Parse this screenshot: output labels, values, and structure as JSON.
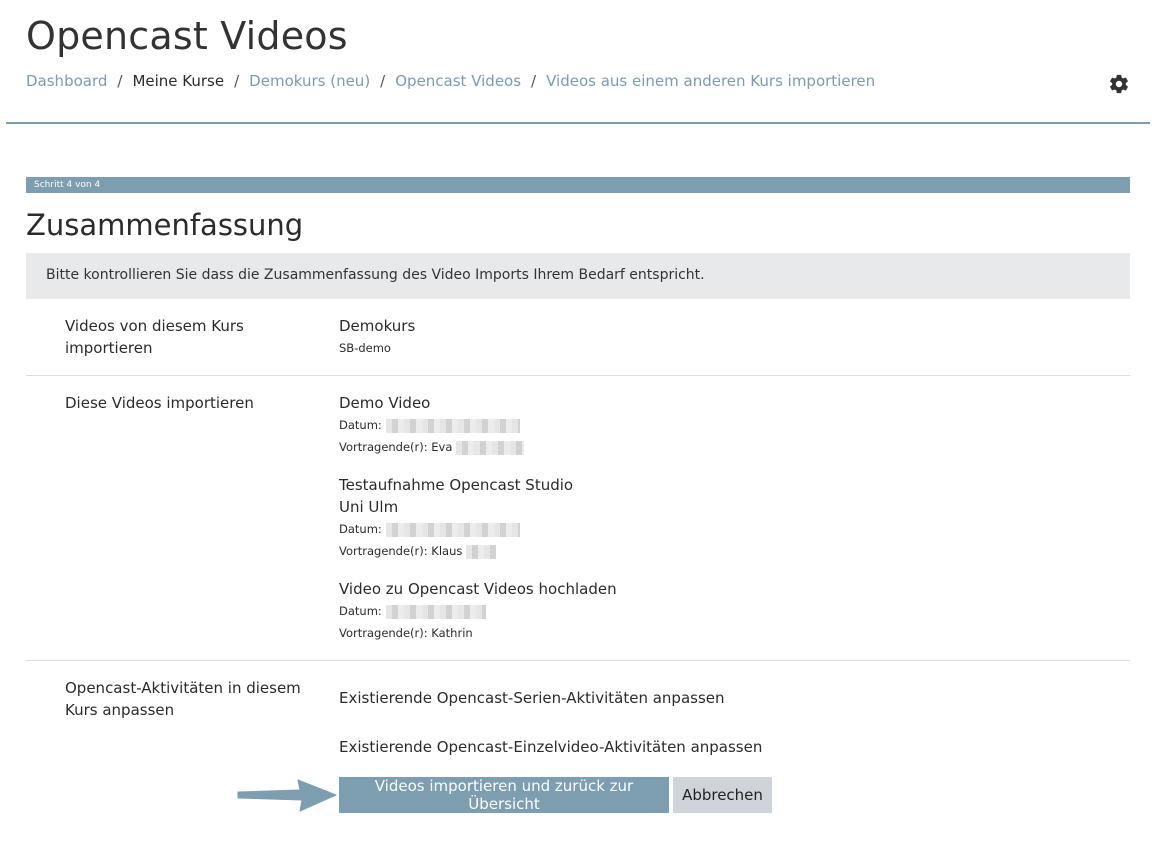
{
  "header": {
    "title": "Opencast Videos",
    "breadcrumb": [
      "Dashboard",
      "Meine Kurse",
      "Demokurs (neu)",
      "Opencast Videos",
      "Videos aus einem anderen Kurs importieren"
    ],
    "settings_icon": "gear-icon"
  },
  "progress": {
    "label": "Schritt 4 von 4",
    "fraction": 1.0
  },
  "summary": {
    "title": "Zusammenfassung",
    "notice": "Bitte kontrollieren Sie dass die Zusammenfassung des Video Imports Ihrem Bedarf entspricht."
  },
  "rows": {
    "source": {
      "label": "Videos von diesem Kurs importieren",
      "course_name": "Demokurs",
      "course_short": "SB-demo"
    },
    "videos": {
      "label": "Diese Videos importieren",
      "items": [
        {
          "title": "Demo Video",
          "date_label": "Datum:",
          "presenter_label": "Vortragende(r): Eva"
        },
        {
          "title": "Testaufnahme Opencast Studio Uni Ulm",
          "date_label": "Datum:",
          "presenter_label": "Vortragende(r): Klaus"
        },
        {
          "title": "Video zu Opencast Videos hochladen",
          "date_label": "Datum:",
          "presenter_label": "Vortragende(r): Kathrin"
        }
      ]
    },
    "activities": {
      "label": "Opencast-Aktivitäten in diesem Kurs anpassen",
      "options": [
        "Existierende Opencast-Serien-Aktivitäten anpassen",
        "Existierende Opencast-Einzelvideo-Aktivitäten anpassen"
      ]
    }
  },
  "actions": {
    "submit_label": "Videos importieren und zurück zur Übersicht",
    "cancel_label": "Abbrechen"
  },
  "colors": {
    "accent": "#7d9db1",
    "link": "#7a9bb0",
    "notice_bg": "#e8e9eb"
  }
}
